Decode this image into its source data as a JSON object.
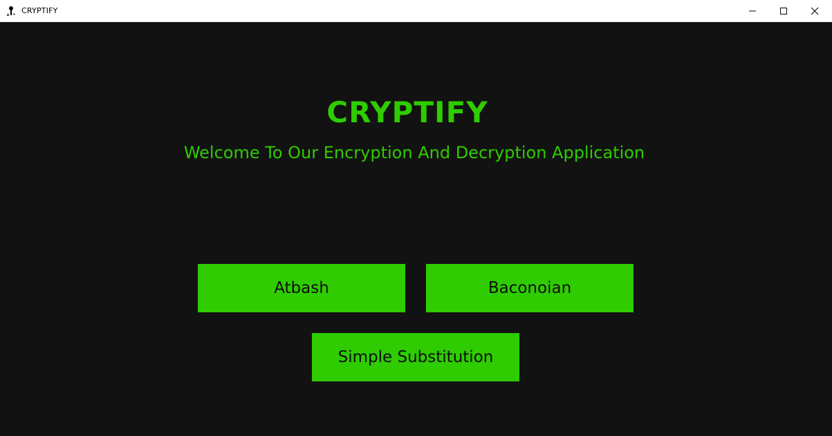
{
  "window": {
    "title": "CRYPTIFY",
    "icon": "keyhole-icon",
    "controls": [
      "minimize-icon",
      "maximize-icon",
      "close-icon"
    ]
  },
  "main": {
    "title": "CRYPTIFY",
    "subtitle": "Welcome To Our Encryption And Decryption Application",
    "buttons": [
      {
        "label": "Atbash"
      },
      {
        "label": "Baconoian"
      },
      {
        "label": "Simple Substitution"
      }
    ]
  },
  "colors": {
    "background": "#121212",
    "accent": "#2ecc00",
    "button_text": "#0e0e0e"
  }
}
